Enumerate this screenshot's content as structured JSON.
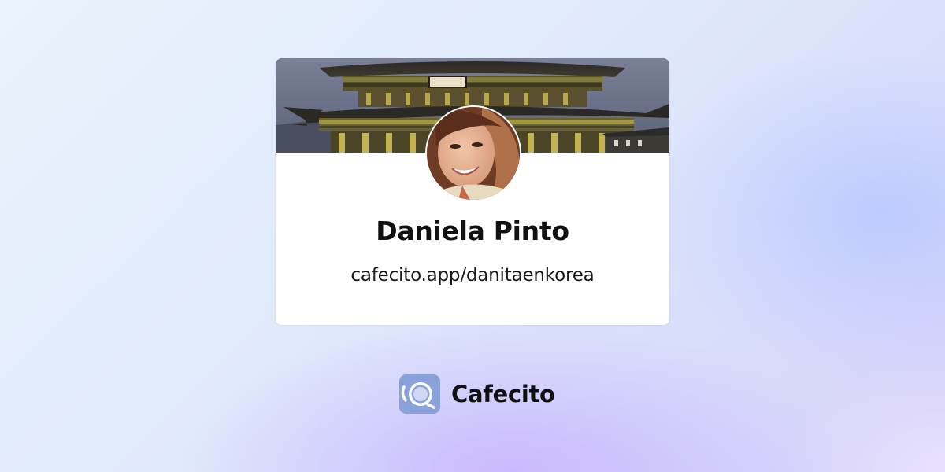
{
  "profile": {
    "name": "Daniela Pinto",
    "url": "cafecito.app/danitaenkorea"
  },
  "brand": {
    "name": "Cafecito",
    "logo_icon": "coffee-cup-icon",
    "logo_color": "#8aa2dc"
  },
  "cover": {
    "description_icon": "palace-cover-photo"
  },
  "avatar": {
    "icon": "avatar-photo"
  }
}
